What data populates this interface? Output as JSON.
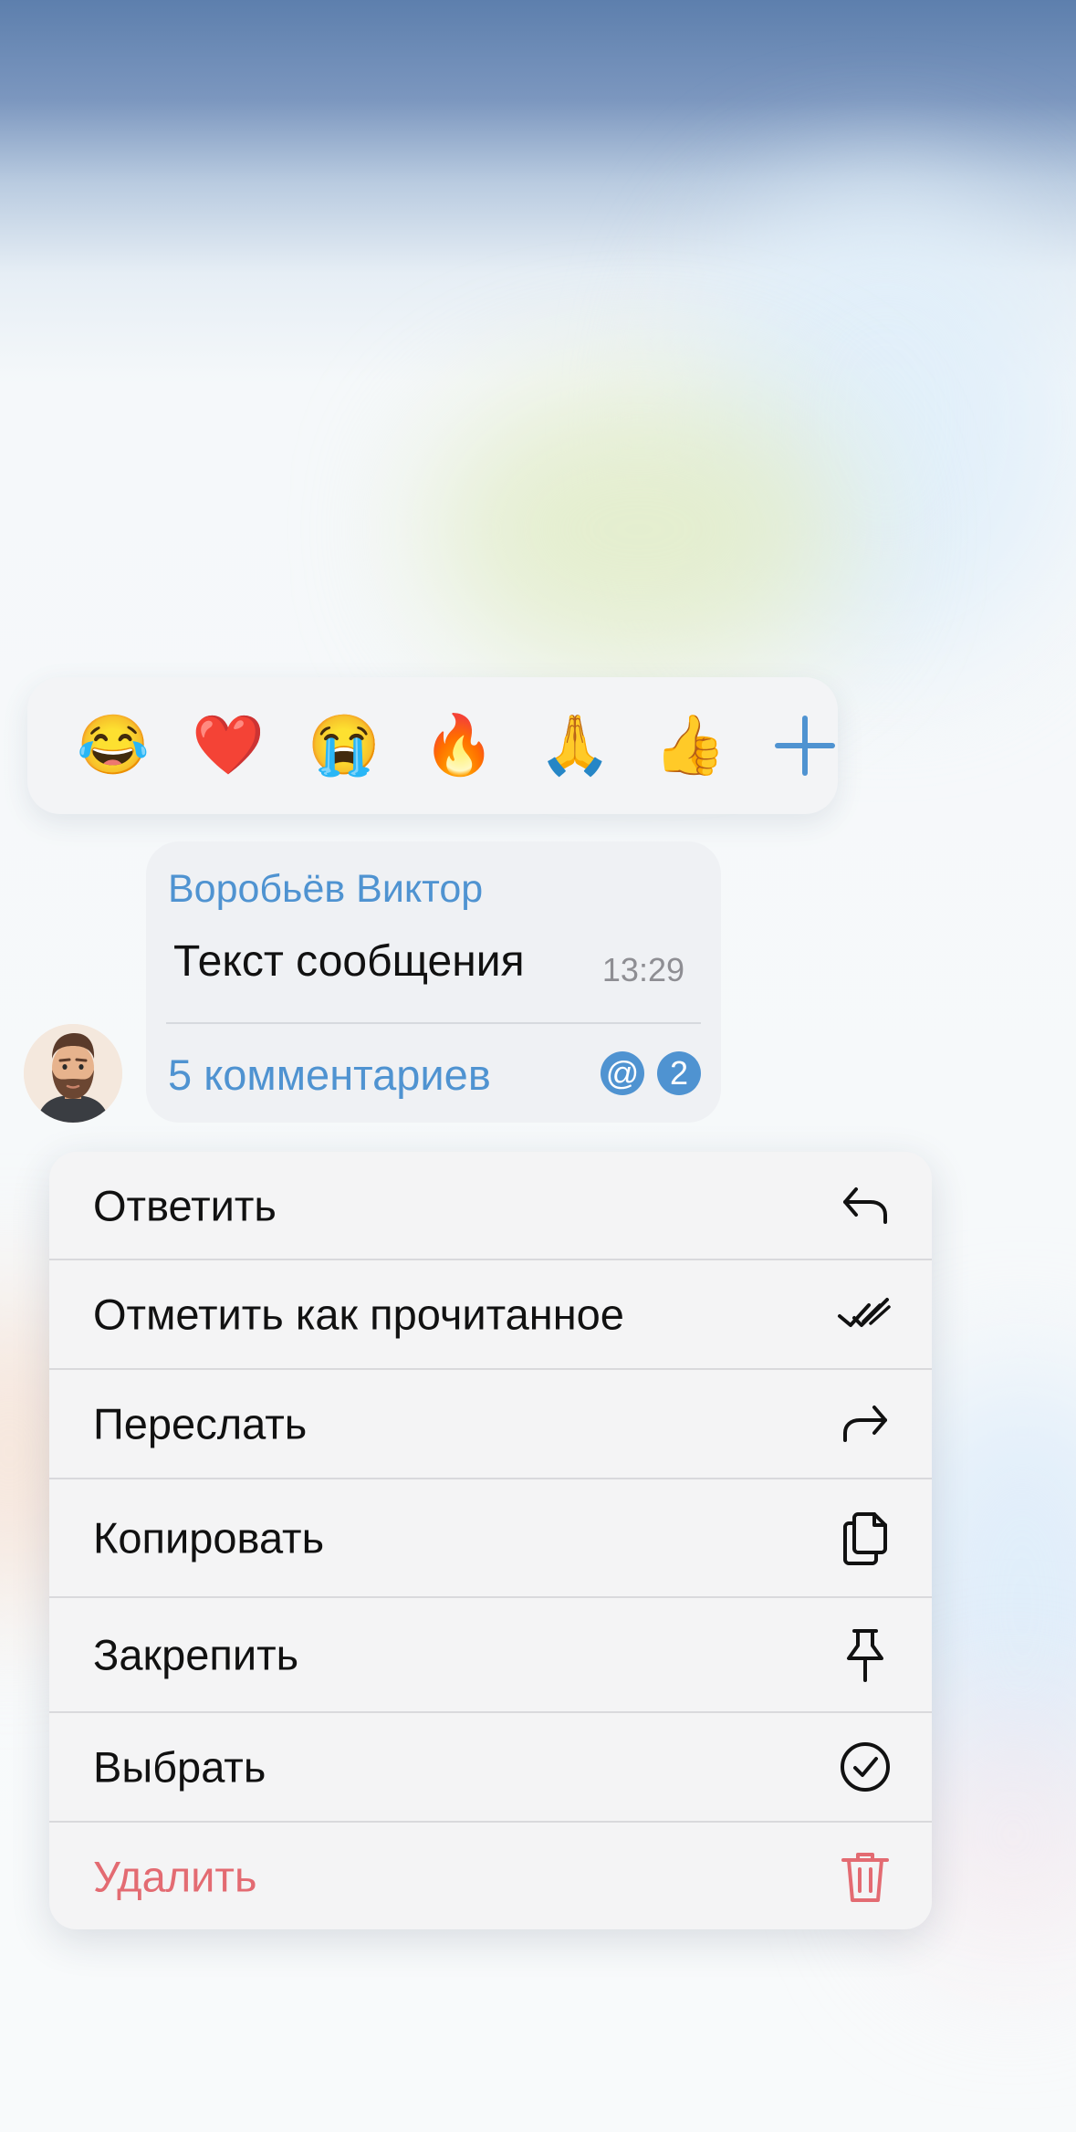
{
  "reactions": [
    {
      "emoji": "😂",
      "name": "laughing-tears"
    },
    {
      "emoji": "❤️",
      "name": "red-heart"
    },
    {
      "emoji": "😭",
      "name": "loudly-crying"
    },
    {
      "emoji": "🔥",
      "name": "fire"
    },
    {
      "emoji": "🙏",
      "name": "folded-hands"
    },
    {
      "emoji": "👍",
      "name": "thumbs-up"
    }
  ],
  "reaction_more": "+",
  "message": {
    "sender": "Воробьёв Виктор",
    "text": "Текст сообщения",
    "time": "13:29",
    "comments_label": "5 комментариев",
    "mention_badge": "@",
    "unread_count": "2"
  },
  "menu": {
    "reply": "Ответить",
    "mark_read": "Отметить как прочитанное",
    "forward": "Переслать",
    "copy": "Копировать",
    "pin": "Закрепить",
    "select": "Выбрать",
    "delete": "Удалить"
  },
  "colors": {
    "accent": "#4f93d1",
    "danger": "#e36b72",
    "text": "#111111",
    "secondary": "#8e8e93"
  },
  "icons": {
    "reply": "reply-arrow-icon",
    "mark_read": "double-check-icon",
    "forward": "forward-arrow-icon",
    "copy": "copy-documents-icon",
    "pin": "pin-icon",
    "select": "check-circle-icon",
    "delete": "trash-icon"
  }
}
